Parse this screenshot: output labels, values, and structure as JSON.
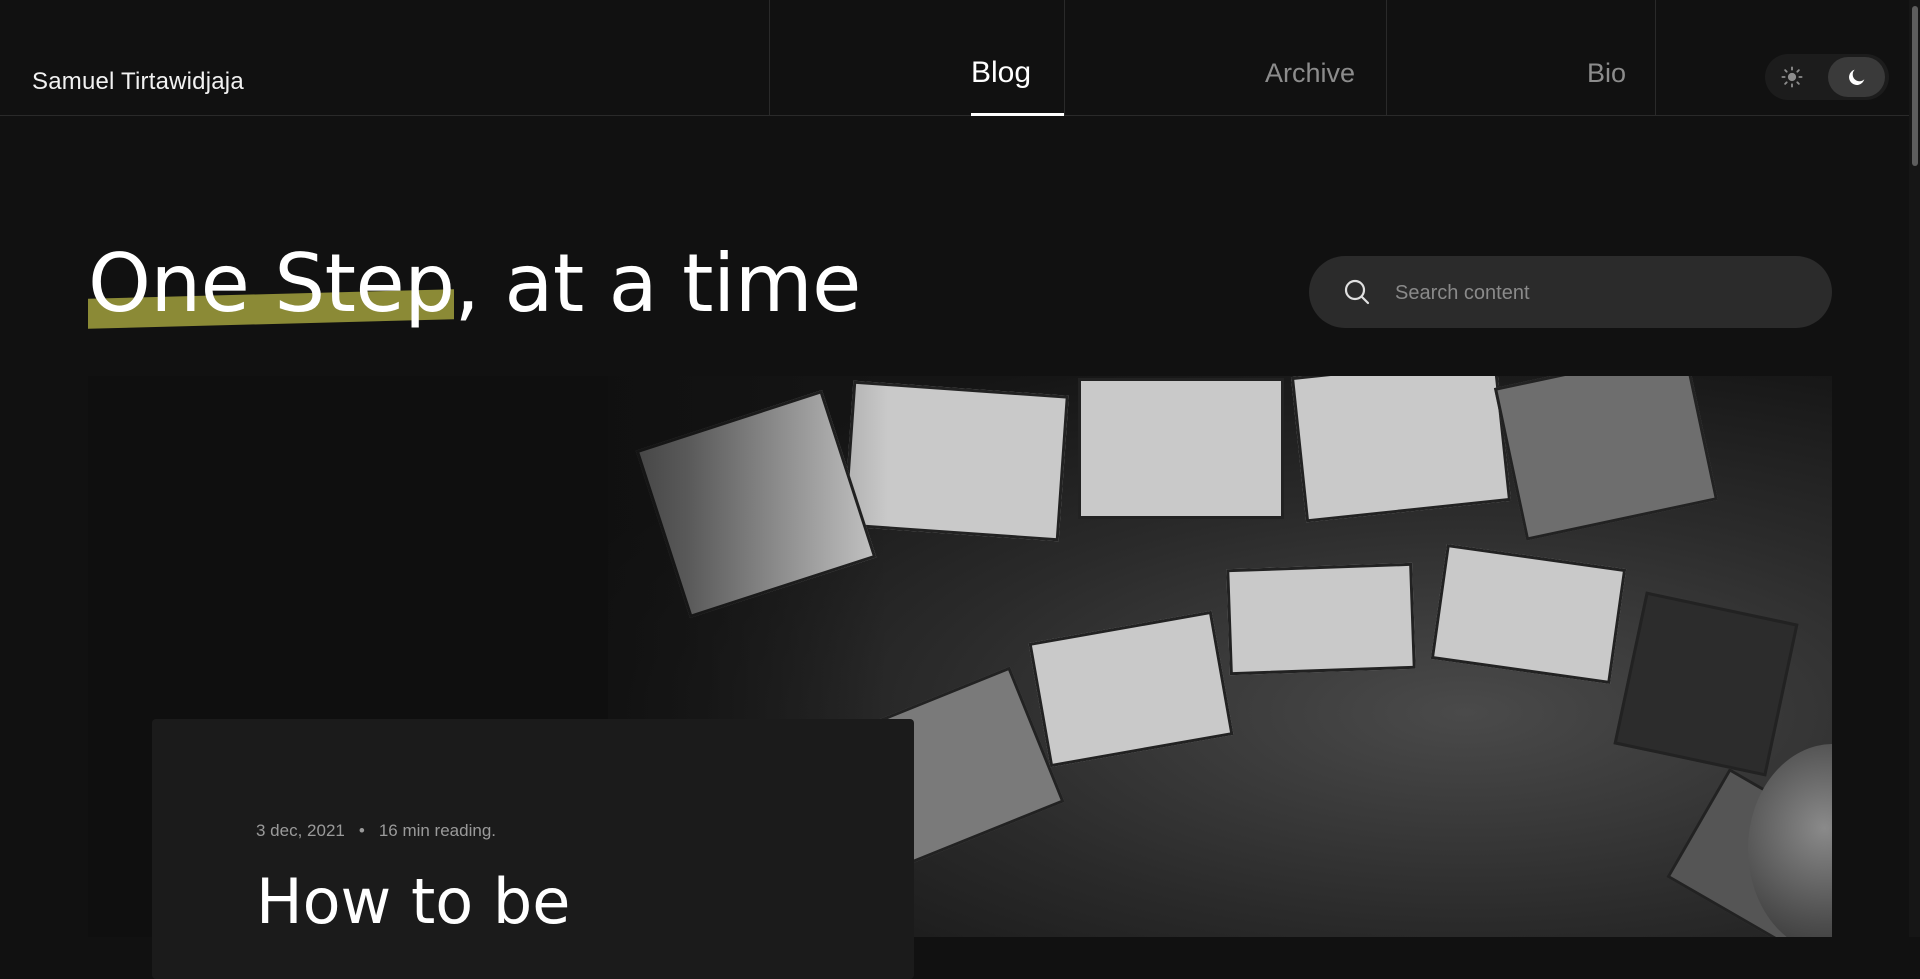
{
  "header": {
    "brand": "Samuel Tirtawidjaja",
    "nav": [
      {
        "label": "Blog",
        "active": true
      },
      {
        "label": "Archive",
        "active": false
      },
      {
        "label": "Bio",
        "active": false
      }
    ],
    "theme": {
      "current": "dark",
      "options": [
        "sun-icon",
        "moon-icon"
      ]
    }
  },
  "hero": {
    "headline_highlight": "One Step",
    "headline_rest": ", at a time",
    "highlight_color": "#8b8a36"
  },
  "search": {
    "placeholder": "Search content",
    "value": ""
  },
  "featured_post": {
    "date": "3 dec, 2021",
    "separator": "•",
    "reading_time": "16 min reading.",
    "title": "How to be",
    "image": "desk-with-many-monitors-photo"
  },
  "colors": {
    "background": "#111111",
    "card": "#1b1b1b",
    "search_bg": "#2b2b2b"
  }
}
